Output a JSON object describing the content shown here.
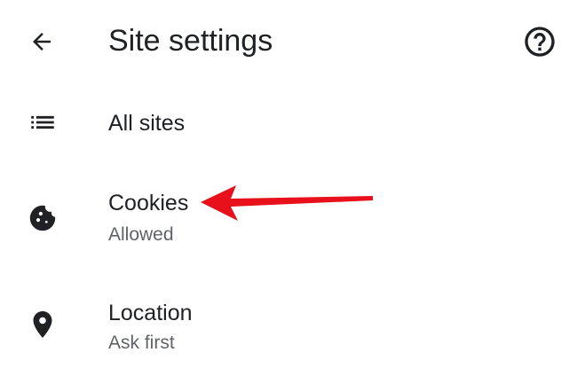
{
  "appbar": {
    "title": "Site settings",
    "back_icon": "arrow-back-icon",
    "help_icon": "help-circle-icon"
  },
  "items": [
    {
      "label": "All sites",
      "icon": "list-icon"
    },
    {
      "label": "Cookies",
      "subtitle": "Allowed",
      "icon": "cookie-icon"
    },
    {
      "label": "Location",
      "subtitle": "Ask first",
      "icon": "location-pin-icon"
    }
  ],
  "colors": {
    "text_primary": "#202124",
    "text_secondary": "#5f6368",
    "annotation_arrow": "#e8111b"
  }
}
